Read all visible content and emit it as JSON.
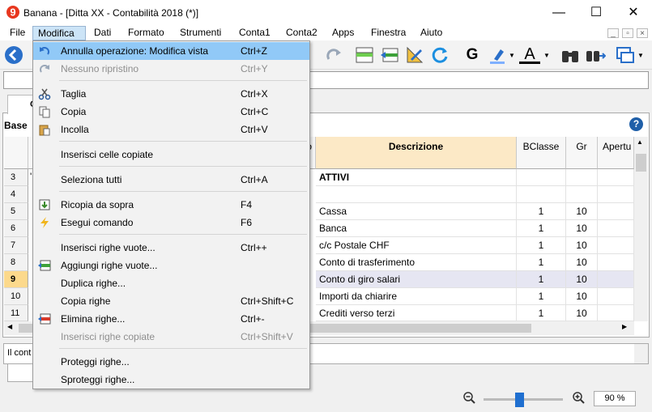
{
  "window": {
    "title": "Banana - [Ditta XX - Contabilità 2018 (*)]",
    "minimize_glyph": "—",
    "maximize_glyph": "☐",
    "close_glyph": "✕"
  },
  "menubar": {
    "items": [
      "File",
      "Modifica",
      "Dati",
      "Formato",
      "Strumenti",
      "Conta1",
      "Conta2",
      "Apps",
      "Finestra",
      "Aiuto"
    ],
    "active": "Modifica",
    "mdi_buttons": [
      "_",
      "▫",
      "×"
    ]
  },
  "toolbar": {
    "icons": [
      "back-arrow-icon",
      "undo-icon",
      "redo-icon",
      "insert-rows-icon",
      "add-rows-icon",
      "edit-pen-icon",
      "refresh-icon",
      "bold-icon",
      "highlight-icon",
      "font-color-icon",
      "binoculars-icon",
      "find-replace-icon",
      "window-switch-icon"
    ],
    "bold_label": "G",
    "font_color_label": "A"
  },
  "tabs": {
    "first_tab_initial": "C",
    "view_label": "Base"
  },
  "table": {
    "columns": [
      "Descrizione",
      "BClasse",
      "Gr",
      "Apertu"
    ],
    "partial_header_letter": "o",
    "rows": [
      {
        "num": "3",
        "marker": "'",
        "descrizione": "ATTIVI",
        "bclasse": "",
        "gr": "",
        "bold": true
      },
      {
        "num": "4",
        "marker": "",
        "descrizione": "",
        "bclasse": "",
        "gr": ""
      },
      {
        "num": "5",
        "marker": "",
        "descrizione": "Cassa",
        "bclasse": "1",
        "gr": "10"
      },
      {
        "num": "6",
        "marker": "",
        "descrizione": "Banca",
        "bclasse": "1",
        "gr": "10"
      },
      {
        "num": "7",
        "marker": "",
        "descrizione": "c/c Postale CHF",
        "bclasse": "1",
        "gr": "10"
      },
      {
        "num": "8",
        "marker": "",
        "descrizione": "Conto di trasferimento",
        "bclasse": "1",
        "gr": "10"
      },
      {
        "num": "9",
        "marker": "",
        "descrizione": "Conto di giro salari",
        "bclasse": "1",
        "gr": "10",
        "selected": true
      },
      {
        "num": "10",
        "marker": "",
        "descrizione": "Importi da chiarire",
        "bclasse": "1",
        "gr": "10"
      },
      {
        "num": "11",
        "marker": "",
        "descrizione": "Crediti verso terzi",
        "bclasse": "1",
        "gr": "10"
      }
    ]
  },
  "info_panel": {
    "text": "Il cont"
  },
  "status": {
    "zoom_value": "90 %",
    "zoom_level": 0.45
  },
  "dropdown": {
    "items": [
      {
        "label": "Annulla operazione: Modifica vista",
        "shortcut": "Ctrl+Z",
        "icon": "undo-icon",
        "highlighted": true
      },
      {
        "label": "Nessuno ripristino",
        "shortcut": "Ctrl+Y",
        "icon": "redo-icon",
        "disabled": true
      },
      {
        "label": "Taglia",
        "shortcut": "Ctrl+X",
        "icon": "scissors-icon"
      },
      {
        "label": "Copia",
        "shortcut": "Ctrl+C",
        "icon": "copy-icon"
      },
      {
        "label": "Incolla",
        "shortcut": "Ctrl+V",
        "icon": "paste-icon"
      },
      {
        "label": "Inserisci celle copiate",
        "shortcut": ""
      },
      {
        "label": "Seleziona tutti",
        "shortcut": "Ctrl+A"
      },
      {
        "label": "Ricopia da sopra",
        "shortcut": "F4",
        "icon": "copy-down-icon"
      },
      {
        "label": "Esegui comando",
        "shortcut": "F6",
        "icon": "lightning-icon"
      },
      {
        "label": "Inserisci righe vuote...",
        "shortcut": "Ctrl++"
      },
      {
        "label": "Aggiungi righe vuote...",
        "shortcut": "",
        "icon": "add-rows-icon"
      },
      {
        "label": "Duplica righe...",
        "shortcut": ""
      },
      {
        "label": "Copia righe",
        "shortcut": "Ctrl+Shift+C"
      },
      {
        "label": "Elimina righe...",
        "shortcut": "Ctrl+-",
        "icon": "delete-rows-icon"
      },
      {
        "label": "Inserisci righe copiate",
        "shortcut": "Ctrl+Shift+V",
        "disabled": true
      },
      {
        "label": "Proteggi righe...",
        "shortcut": ""
      },
      {
        "label": "Sproteggi righe...",
        "shortcut": ""
      }
    ]
  }
}
